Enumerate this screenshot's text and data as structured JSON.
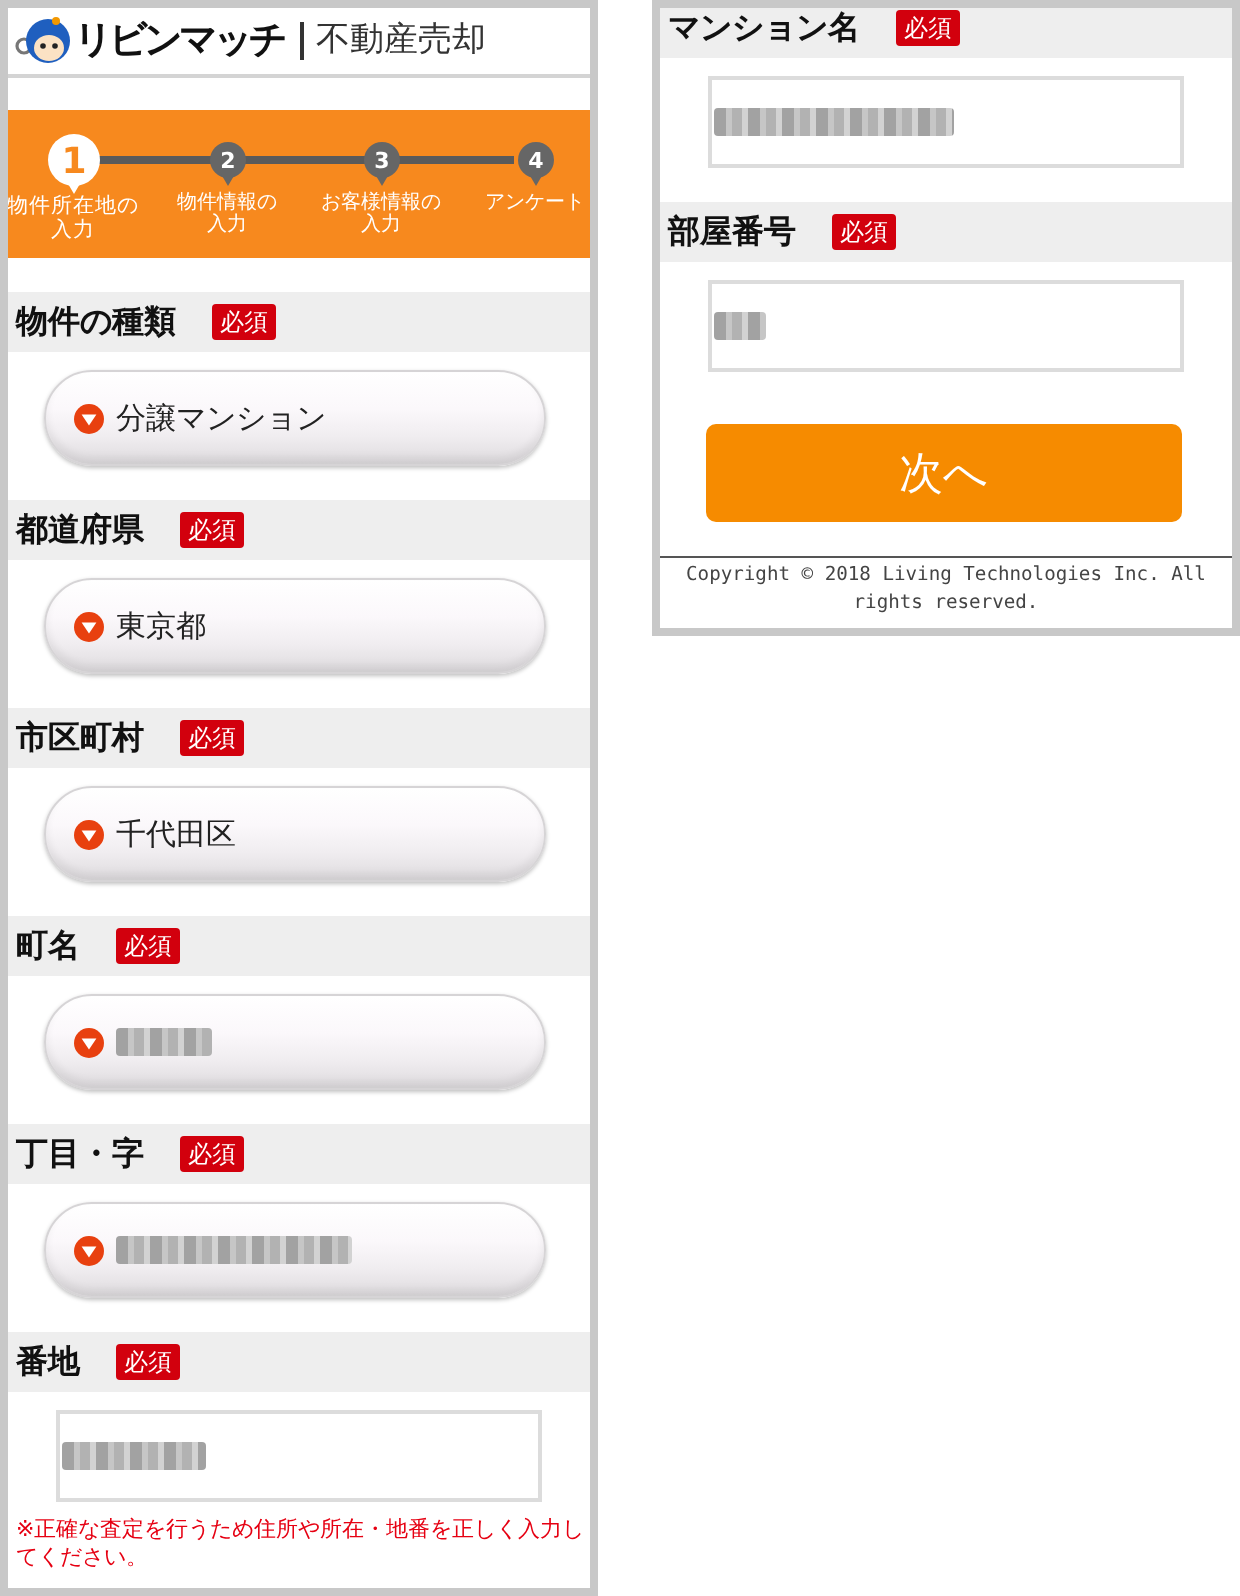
{
  "left_panel": {
    "header": {
      "logo_text": "リビンマッチ",
      "title": "不動産売却"
    },
    "steps": [
      {
        "number": "1",
        "label": "物件所在地の入力",
        "selected": true
      },
      {
        "number": "2",
        "label": "物件情報の入力",
        "selected": false
      },
      {
        "number": "3",
        "label": "お客様情報の入力",
        "selected": false
      },
      {
        "number": "4",
        "label": "アンケート",
        "selected": false
      }
    ],
    "fields": [
      {
        "label": "物件の種類",
        "badge": "必須",
        "kind": "select",
        "value": "分譲マンション",
        "blurred": false
      },
      {
        "label": "都道府県",
        "badge": "必須",
        "kind": "select",
        "value": "東京都",
        "blurred": false
      },
      {
        "label": "市区町村",
        "badge": "必須",
        "kind": "select",
        "value": "千代田区",
        "blurred": false
      },
      {
        "label": "町名",
        "badge": "必須",
        "kind": "select",
        "blurred": true
      },
      {
        "label": "丁目・字",
        "badge": "必須",
        "kind": "select",
        "blurred": true
      },
      {
        "label": "番地",
        "badge": "必須",
        "kind": "text",
        "blurred": true,
        "note": "※正確な査定を行うため住所や所在・地番を正しく入力してください。"
      }
    ]
  },
  "right_panel": {
    "fields": [
      {
        "label": "マンション名",
        "badge": "必須",
        "kind": "text",
        "blurred": true
      },
      {
        "label": "部屋番号",
        "badge": "必須",
        "kind": "text",
        "blurred": true
      }
    ],
    "next_button": "次へ",
    "copyright": "Copyright © 2018 Living Technologies Inc. All rights reserved."
  }
}
